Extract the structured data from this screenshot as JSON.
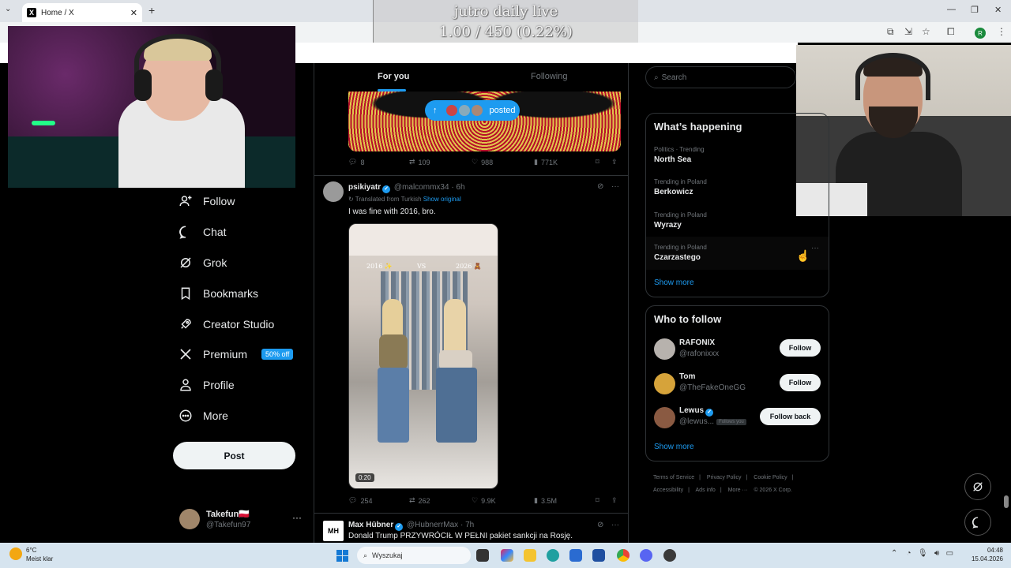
{
  "browser": {
    "tab_title": "Home / X",
    "tab_close": "✕",
    "new_tab": "+",
    "tab_menu": "⌄",
    "window_controls": [
      "—",
      "❐",
      "✕"
    ],
    "profile_initial": "R"
  },
  "overlay": {
    "goal_title": "jutro daily live",
    "goal_count": "1.00 / 450 (0.22%)"
  },
  "nav": {
    "items": [
      {
        "label": "Follow",
        "icon": "add-user-icon"
      },
      {
        "label": "Chat",
        "icon": "chat-icon"
      },
      {
        "label": "Grok",
        "icon": "grok-icon"
      },
      {
        "label": "Bookmarks",
        "icon": "bookmark-icon"
      },
      {
        "label": "Creator Studio",
        "icon": "rocket-icon"
      },
      {
        "label": "Premium",
        "icon": "x-logo-icon"
      },
      {
        "label": "Profile",
        "icon": "person-icon"
      },
      {
        "label": "More",
        "icon": "more-circle-icon"
      }
    ],
    "premium_badge": "50% off",
    "post_label": "Post",
    "account": {
      "name": "Takefun🇵🇱",
      "handle": "@Takefun97",
      "more": "···"
    }
  },
  "feed": {
    "tabs": {
      "for_you": "For you",
      "following": "Following"
    },
    "posted_pill": "posted",
    "post1_actions": {
      "replies": "8",
      "reposts": "109",
      "likes": "988",
      "views": "771K"
    },
    "post2": {
      "name": "psikiyatr",
      "handle": "@malcommx34",
      "time": "· 6h",
      "translated": "Translated from Turkish",
      "show_original": "Show original",
      "text": "I was fine with 2016, bro.",
      "video_left": "2016 ✨",
      "video_vs": "VS",
      "video_right": "2026 🧸",
      "duration": "0:20",
      "actions": {
        "replies": "254",
        "reposts": "262",
        "likes": "9.9K",
        "views": "3.5M"
      }
    },
    "post3": {
      "avatar_text": "MH",
      "name": "Max Hübner",
      "handle": "@HubnerrMax",
      "time": "· 7h",
      "text": "Donald Trump PRZYWRÓCIŁ W PEŁNI pakiet sankcji na Rosję."
    }
  },
  "sidebar": {
    "search_placeholder": "Search",
    "happening_title": "What’s happening",
    "trends": [
      {
        "context": "Politics · Trending",
        "name": "North Sea"
      },
      {
        "context": "Trending in Poland",
        "name": "Berkowicz"
      },
      {
        "context": "Trending in Poland",
        "name": "Wyrazy"
      },
      {
        "context": "Trending in Poland",
        "name": "Czarzastego"
      }
    ],
    "trend_more": "···",
    "show_more": "Show more",
    "who_to_follow_title": "Who to follow",
    "follow_suggestions": [
      {
        "name": "RAFONIX",
        "handle": "@rafonixxx",
        "button": "Follow"
      },
      {
        "name": "Tom",
        "handle": "@TheFakeOneGG",
        "button": "Follow"
      },
      {
        "name": "Lewus",
        "handle": "@lewus...",
        "follows_you": "Follows you",
        "button": "Follow back"
      }
    ],
    "show_more_follow": "Show more",
    "footer": [
      "Terms of Service",
      "|",
      "Privacy Policy",
      "|",
      "Cookie Policy",
      "|",
      "Accessibility",
      "|",
      "Ads info",
      "|",
      "More ···",
      "© 2026 X Corp."
    ]
  },
  "taskbar": {
    "weather_temp": "6°C",
    "weather_desc": "Meist klar",
    "search_placeholder": "Wyszukaj",
    "time": "04:48",
    "date": "15.04.2026"
  },
  "colors": {
    "accent": "#1d9bf0",
    "background": "#000000",
    "border": "#2f3336"
  }
}
